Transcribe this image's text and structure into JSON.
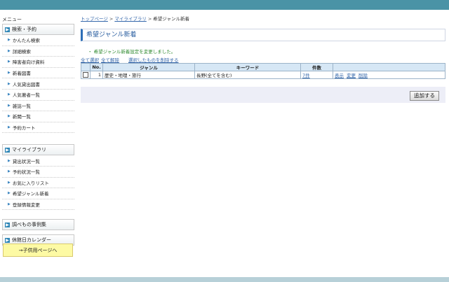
{
  "sidebar": {
    "menu_title": "メニュー",
    "search_section": "検索・予約",
    "search_items": [
      {
        "label": "かんたん検索"
      },
      {
        "label": "詳細検索"
      },
      {
        "label": "障害者向け資料"
      },
      {
        "label": "新着図書"
      },
      {
        "label": "人気貸出図書"
      },
      {
        "label": "人気著者一覧"
      },
      {
        "label": "雑誌一覧"
      },
      {
        "label": "新聞一覧"
      },
      {
        "label": "予約カート"
      }
    ],
    "library_section": "マイライブラリ",
    "library_items": [
      {
        "label": "貸出状況一覧"
      },
      {
        "label": "予約状況一覧"
      },
      {
        "label": "お気に入りリスト"
      },
      {
        "label": "希望ジャンル新着"
      },
      {
        "label": "登録情報変更"
      }
    ],
    "reference_section": "調べもの事例集",
    "calendar_section": "休館日カレンダー",
    "kids_link": "→子供用ページへ"
  },
  "breadcrumb": {
    "top": "トップページ",
    "library": "マイライブラリ",
    "current": "希望ジャンル新着",
    "sep": ">"
  },
  "page_title": "希望ジャンル新着",
  "message": "・ 希望ジャンル新着設定を変更しました。",
  "actions": {
    "select_all": "全て選択",
    "clear_all": "全て解除",
    "delete_selected": "選択したものを削除する"
  },
  "table": {
    "headers": {
      "no": "No.",
      "genre": "ジャンル",
      "keyword": "キーワード",
      "count": "件数"
    },
    "rows": [
      {
        "no": "1",
        "genre": "歴史・地理・旅行",
        "keyword": "長野(全てを含む)",
        "count": "7件",
        "show": "表示",
        "edit": "変更",
        "delete": "削除"
      }
    ]
  },
  "add_button": "追加する",
  "colors": {
    "header_bar": "#4a93a6",
    "title_accent": "#2e6fb7",
    "message": "#2f8a2f",
    "kids_bg": "#fdfaa4"
  }
}
